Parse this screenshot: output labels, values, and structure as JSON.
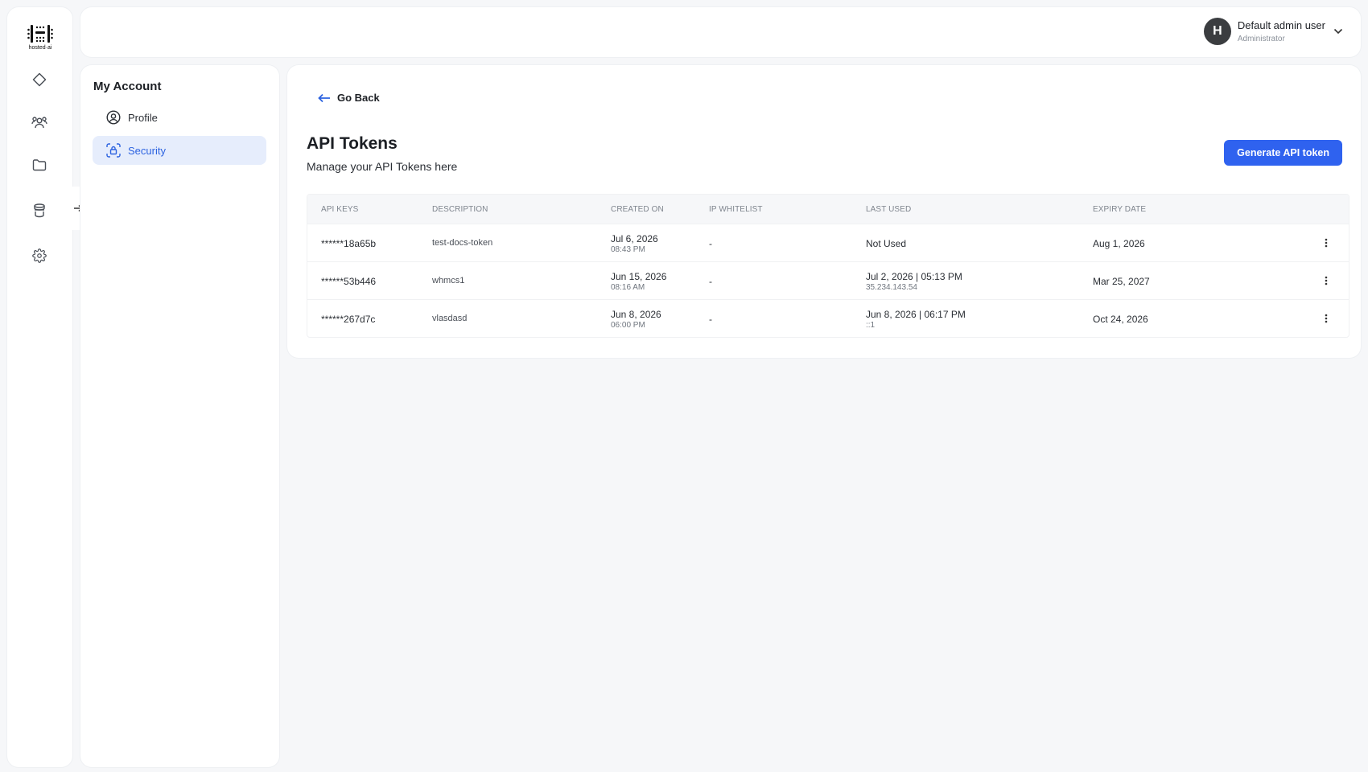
{
  "brand": {
    "logo_text": "hosted·ai"
  },
  "user": {
    "initial": "H",
    "name": "Default admin user",
    "role": "Administrator"
  },
  "subnav": {
    "title": "My Account",
    "items": [
      {
        "label": "Profile",
        "icon": "user-circle-icon",
        "active": false
      },
      {
        "label": "Security",
        "icon": "lock-scan-icon",
        "active": true
      }
    ]
  },
  "main": {
    "go_back": "Go Back",
    "title": "API Tokens",
    "subtitle": "Manage your API Tokens here",
    "generate_button": "Generate API token",
    "accent_color": "#2f62ef"
  },
  "table": {
    "columns": [
      "API KEYS",
      "DESCRIPTION",
      "CREATED ON",
      "IP WHITELIST",
      "LAST USED",
      "EXPIRY DATE"
    ],
    "rows": [
      {
        "key": "******18a65b",
        "description": "test-docs-token",
        "created_date": "Jul 6, 2026",
        "created_time": "08:43 PM",
        "ip": "-",
        "last_used": "Not Used",
        "last_used_ip": "",
        "expiry": "Aug 1, 2026"
      },
      {
        "key": "******53b446",
        "description": "whmcs1",
        "created_date": "Jun 15, 2026",
        "created_time": "08:16 AM",
        "ip": "-",
        "last_used": "Jul 2, 2026 | 05:13 PM",
        "last_used_ip": "35.234.143.54",
        "expiry": "Mar 25, 2027"
      },
      {
        "key": "******267d7c",
        "description": "vlasdasd",
        "created_date": "Jun 8, 2026",
        "created_time": "06:00 PM",
        "ip": "-",
        "last_used": "Jun 8, 2026 | 06:17 PM",
        "last_used_ip": "::1",
        "expiry": "Oct 24, 2026"
      }
    ]
  }
}
